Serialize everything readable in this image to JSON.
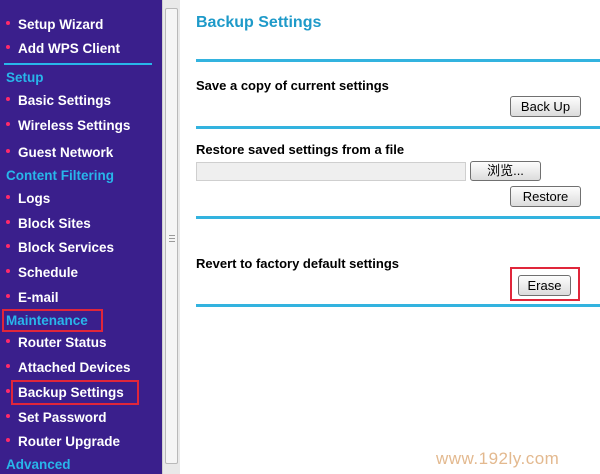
{
  "sidebar": {
    "items": [
      {
        "label": "Setup Wizard"
      },
      {
        "label": "Add WPS Client"
      },
      {
        "label": "Basic Settings"
      },
      {
        "label": "Wireless Settings"
      },
      {
        "label": "Guest Network"
      },
      {
        "label": "Logs"
      },
      {
        "label": "Block Sites"
      },
      {
        "label": "Block Services"
      },
      {
        "label": "Schedule"
      },
      {
        "label": "E-mail"
      },
      {
        "label": "Router Status"
      },
      {
        "label": "Attached Devices"
      },
      {
        "label": "Backup Settings",
        "active": true
      },
      {
        "label": "Set Password"
      },
      {
        "label": "Router Upgrade"
      }
    ],
    "sections": {
      "setup": "Setup",
      "content_filtering": "Content Filtering",
      "maintenance": "Maintenance",
      "advanced": "Advanced"
    }
  },
  "main": {
    "title": "Backup Settings",
    "backup": {
      "label": "Save a copy of current settings",
      "button": "Back Up"
    },
    "restore": {
      "label": "Restore saved settings from a file",
      "browse_button": "浏览...",
      "file_value": "",
      "button": "Restore"
    },
    "erase": {
      "label": "Revert to factory default settings",
      "button": "Erase"
    }
  },
  "watermark": "www.192ly.com",
  "colors": {
    "sidebar_bg": "#3a1f8c",
    "section_text": "#28b6ea",
    "bullet": "#ff2a6a",
    "title": "#1e9ac9",
    "rule": "#33b3df",
    "highlight_box": "#e0263a"
  }
}
